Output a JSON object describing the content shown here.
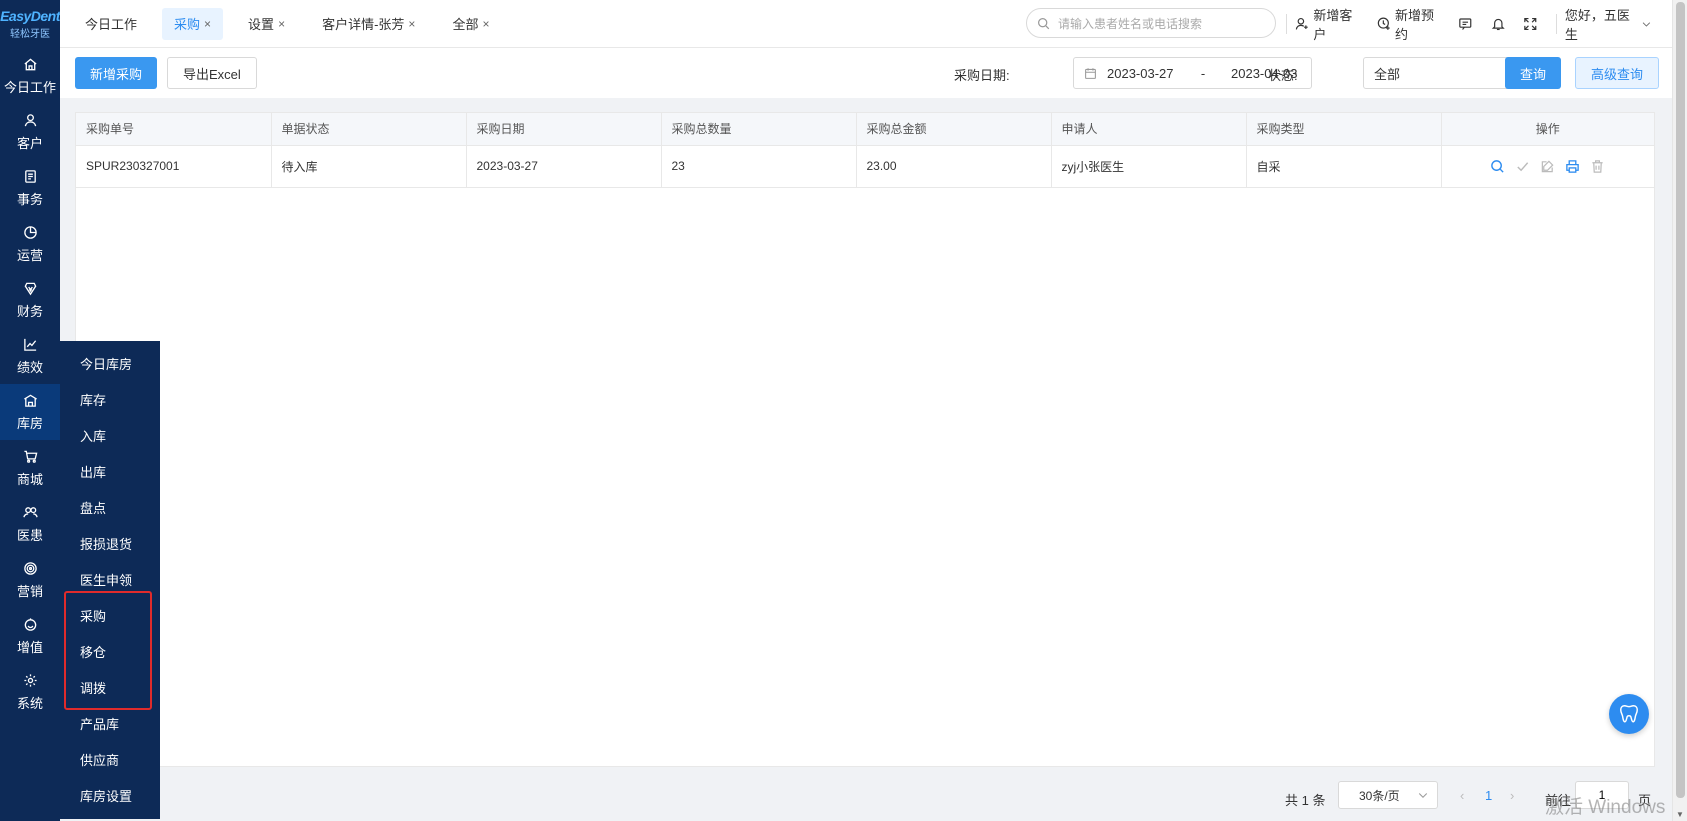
{
  "logo": {
    "brand": "EasyDent",
    "subtitle": "轻松牙医"
  },
  "sidebar": {
    "items": [
      {
        "label": "今日工作",
        "icon": "home-icon"
      },
      {
        "label": "客户",
        "icon": "user-icon"
      },
      {
        "label": "事务",
        "icon": "document-icon"
      },
      {
        "label": "运营",
        "icon": "pie-chart-icon"
      },
      {
        "label": "财务",
        "icon": "finance-icon"
      },
      {
        "label": "绩效",
        "icon": "line-chart-icon"
      },
      {
        "label": "库房",
        "icon": "warehouse-icon"
      },
      {
        "label": "商城",
        "icon": "cart-icon"
      },
      {
        "label": "医患",
        "icon": "people-icon"
      },
      {
        "label": "营销",
        "icon": "target-icon"
      },
      {
        "label": "增值",
        "icon": "smile-icon"
      },
      {
        "label": "系统",
        "icon": "gear-icon"
      }
    ]
  },
  "flyout": {
    "items": [
      "今日库房",
      "库存",
      "入库",
      "出库",
      "盘点",
      "报损退货",
      "医生申领",
      "采购",
      "移仓",
      "调拨",
      "产品库",
      "供应商",
      "库房设置"
    ]
  },
  "tabs": [
    {
      "label": "今日工作",
      "closable": false
    },
    {
      "label": "采购",
      "closable": true
    },
    {
      "label": "设置",
      "closable": true
    },
    {
      "label": "客户详情-张芳",
      "closable": true
    },
    {
      "label": "全部",
      "closable": true
    }
  ],
  "tab_close_glyph": "×",
  "header": {
    "search_placeholder": "请输入患者姓名或电话搜索",
    "new_customer": "新增客户",
    "new_appointment": "新增预约",
    "greeting": "您好，五医生"
  },
  "toolbar": {
    "add_button": "新增采购",
    "export_button": "导出Excel",
    "date_label": "采购日期:",
    "date_start": "2023-03-27",
    "date_separator": "-",
    "date_end": "2023-04-03",
    "status_label": "状态:",
    "status_value": "全部",
    "query_button": "查询",
    "advanced_button": "高级查询"
  },
  "table": {
    "columns": [
      "采购单号",
      "单据状态",
      "采购日期",
      "采购总数量",
      "采购总金额",
      "申请人",
      "采购类型",
      "操作"
    ],
    "rows": [
      [
        "SPUR230327001",
        "待入库",
        "2023-03-27",
        "23",
        "23.00",
        "zyj小张医生",
        "自采"
      ]
    ]
  },
  "pagination": {
    "total": "共 1 条",
    "page_size": "30条/页",
    "prev": "‹",
    "current_page": "1",
    "next": "›",
    "goto_label": "前往",
    "goto_value": "1",
    "page_suffix": "页"
  },
  "watermark": "激活 Windows",
  "colors": {
    "accent": "#2d8cf0",
    "sidebar": "#0d2a57",
    "highlight": "#e02b2b"
  }
}
